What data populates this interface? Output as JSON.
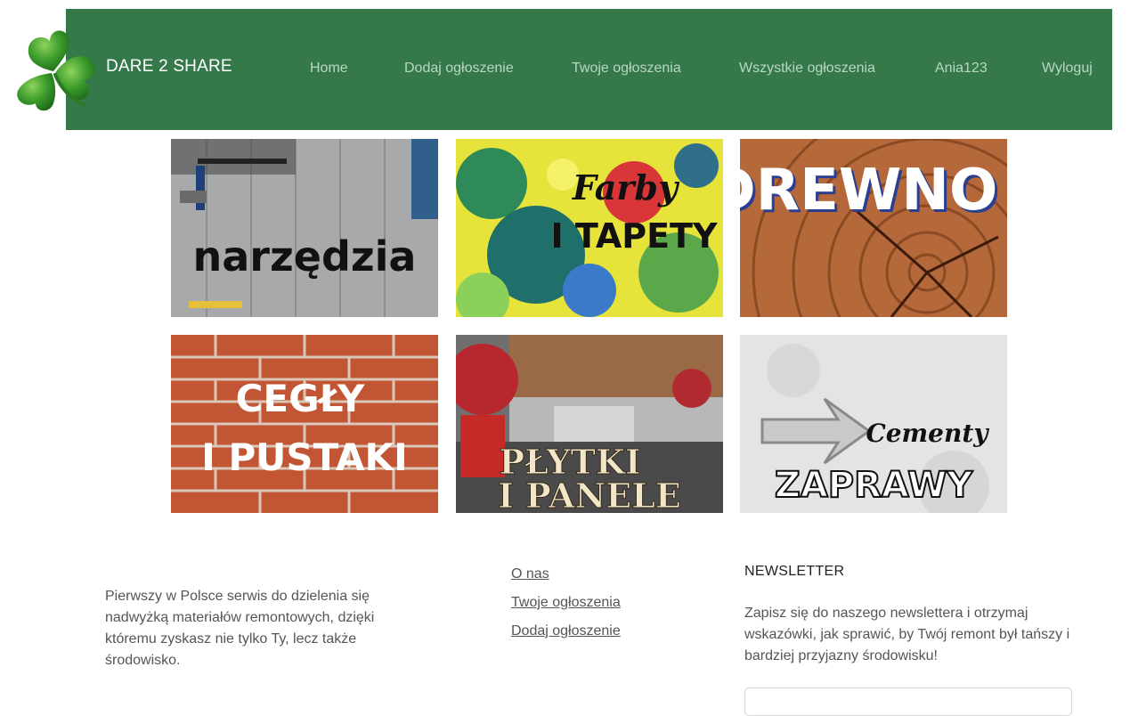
{
  "brand": {
    "name": "DARE 2 SHARE"
  },
  "nav": {
    "home": "Home",
    "add": "Dodaj ogłoszenie",
    "yours": "Twoje ogłoszenia",
    "all": "Wszystkie ogłoszenia",
    "user": "Ania123",
    "logout": "Wyloguj"
  },
  "categories": [
    {
      "title": "narzędzia"
    },
    {
      "title_script": "Farby",
      "title": "I TAPETY"
    },
    {
      "title": "DREWNO"
    },
    {
      "title": "CEGŁY",
      "title2": "I PUSTAKI"
    },
    {
      "title": "PŁYTKI",
      "title2": "I PANELE"
    },
    {
      "title_script": "Cementy",
      "title": "ZAPRAWY"
    }
  ],
  "footer": {
    "about": "Pierwszy w Polsce serwis do dzielenia się nadwyżką materiałów remontowych, dzięki któremu zyskasz nie tylko Ty, lecz także środowisko.",
    "links": {
      "about_us": "O nas",
      "your_ads": "Twoje ogłoszenia",
      "add_ad": "Dodaj ogłoszenie"
    },
    "newsletter": {
      "title": "NEWSLETTER",
      "text": "Zapisz się do naszego newslettera i otrzymaj wskazówki, jak sprawić, by Twój remont był tańszy i bardziej przyjazny środowisku!"
    }
  },
  "colors": {
    "nav_bg": "#35794a",
    "nav_link": "#b9d6c2",
    "brand_text": "#ffffff"
  }
}
